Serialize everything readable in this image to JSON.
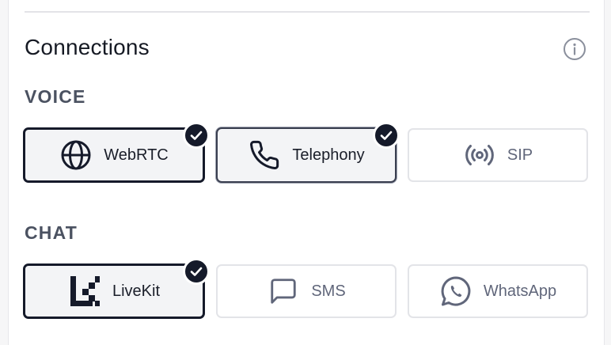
{
  "header": {
    "title": "Connections",
    "info_icon": "info-circle-icon"
  },
  "sections": {
    "voice": {
      "label": "VOICE",
      "options": [
        {
          "label": "WebRTC",
          "icon": "globe-icon",
          "selected": true
        },
        {
          "label": "Telephony",
          "icon": "phone-icon",
          "selected": true
        },
        {
          "label": "SIP",
          "icon": "broadcast-icon",
          "selected": false
        }
      ]
    },
    "chat": {
      "label": "CHAT",
      "options": [
        {
          "label": "LiveKit",
          "icon": "livekit-logo-icon",
          "selected": true
        },
        {
          "label": "SMS",
          "icon": "message-square-icon",
          "selected": false
        },
        {
          "label": "WhatsApp",
          "icon": "whatsapp-icon",
          "selected": false
        }
      ]
    }
  },
  "colors": {
    "selected_border": "#151a2a",
    "unselected_border": "#e3e4e8",
    "check_badge": "#151a2a",
    "muted_text": "#60667a"
  }
}
